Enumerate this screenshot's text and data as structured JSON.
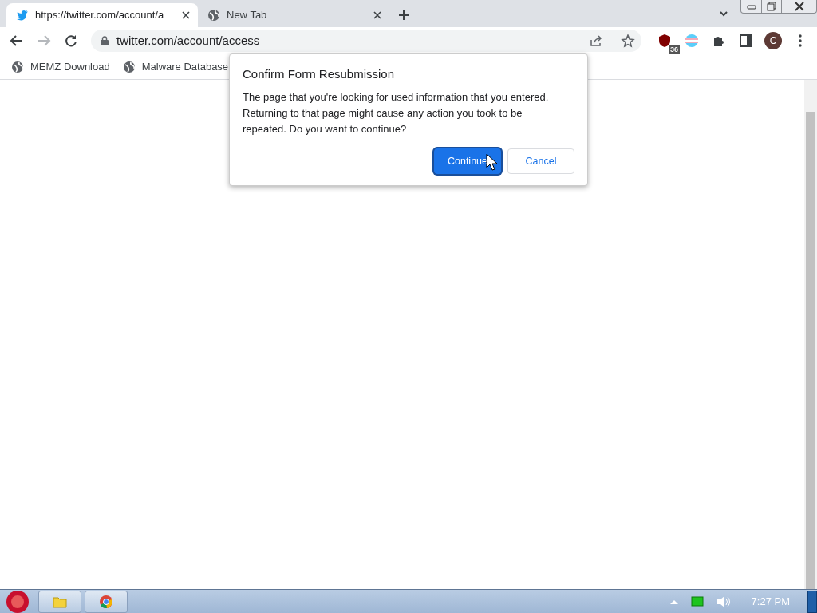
{
  "tabs": [
    {
      "title": "https://twitter.com/account/a",
      "kind": "bird",
      "selected": true
    },
    {
      "title": "New Tab",
      "kind": "globe",
      "selected": false
    }
  ],
  "address": "twitter.com/account/access",
  "extension_badge": "36",
  "avatar": "C",
  "bookmarks": [
    "MEMZ Download",
    "Malware Database"
  ],
  "dialog": {
    "title": "Confirm Form Resubmission",
    "message": "The page that you're looking for used information that you entered. Returning to that page might cause any action you took to be repeated. Do you want to continue?",
    "buttons": [
      {
        "label": "Continue",
        "primary": true
      },
      {
        "label": "Cancel",
        "primary": false
      }
    ]
  },
  "clock": "7:27 PM"
}
